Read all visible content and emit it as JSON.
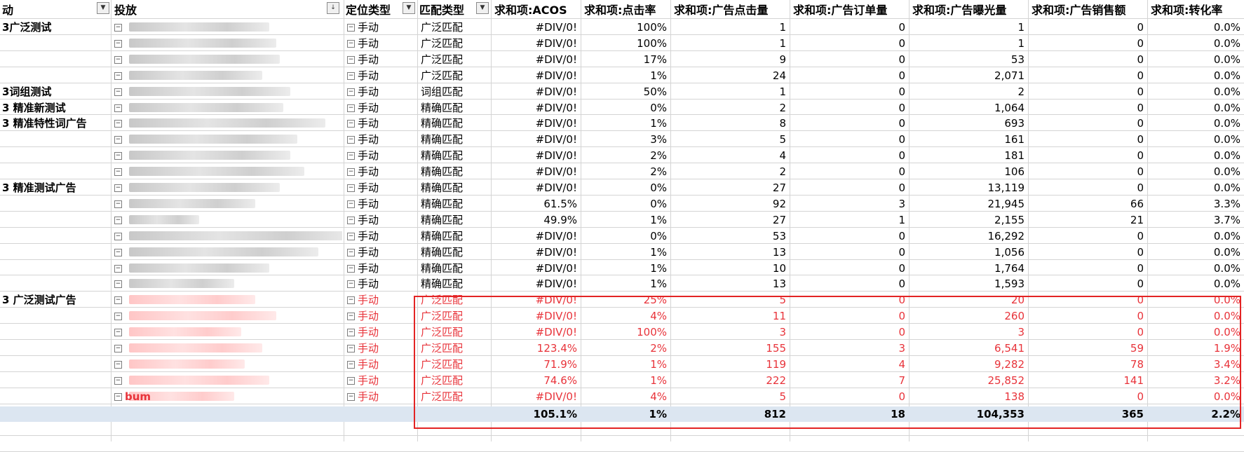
{
  "headers": {
    "campaign": "动",
    "targeting": "投放",
    "position_type": "定位类型",
    "match_type": "匹配类型",
    "acos": "求和项:ACOS",
    "ctr": "求和项:点击率",
    "clicks": "求和项:广告点击量",
    "orders": "求和项:广告订单量",
    "impressions": "求和项:广告曝光量",
    "sales": "求和项:广告销售额",
    "conversion": "求和项:转化率"
  },
  "rows": [
    {
      "campaign": "3广泛测试",
      "targeting": "",
      "position": "手动",
      "match": "广泛匹配",
      "acos": "#DIV/0!",
      "ctr": "100%",
      "clicks": "1",
      "orders": "0",
      "impressions": "1",
      "sales": "0",
      "conversion": "0.0%",
      "red": false
    },
    {
      "campaign": "",
      "targeting": "",
      "position": "手动",
      "match": "广泛匹配",
      "acos": "#DIV/0!",
      "ctr": "100%",
      "clicks": "1",
      "orders": "0",
      "impressions": "1",
      "sales": "0",
      "conversion": "0.0%",
      "red": false
    },
    {
      "campaign": "",
      "targeting": "",
      "position": "手动",
      "match": "广泛匹配",
      "acos": "#DIV/0!",
      "ctr": "17%",
      "clicks": "9",
      "orders": "0",
      "impressions": "53",
      "sales": "0",
      "conversion": "0.0%",
      "red": false
    },
    {
      "campaign": "",
      "targeting": "",
      "position": "手动",
      "match": "广泛匹配",
      "acos": "#DIV/0!",
      "ctr": "1%",
      "clicks": "24",
      "orders": "0",
      "impressions": "2,071",
      "sales": "0",
      "conversion": "0.0%",
      "red": false
    },
    {
      "campaign": "3词组测试",
      "targeting": "",
      "position": "手动",
      "match": "词组匹配",
      "acos": "#DIV/0!",
      "ctr": "50%",
      "clicks": "1",
      "orders": "0",
      "impressions": "2",
      "sales": "0",
      "conversion": "0.0%",
      "red": false
    },
    {
      "campaign": "3 精准新测试",
      "targeting": "",
      "position": "手动",
      "match": "精确匹配",
      "acos": "#DIV/0!",
      "ctr": "0%",
      "clicks": "2",
      "orders": "0",
      "impressions": "1,064",
      "sales": "0",
      "conversion": "0.0%",
      "red": false
    },
    {
      "campaign": "3 精准特性词广告",
      "targeting": "",
      "position": "手动",
      "match": "精确匹配",
      "acos": "#DIV/0!",
      "ctr": "1%",
      "clicks": "8",
      "orders": "0",
      "impressions": "693",
      "sales": "0",
      "conversion": "0.0%",
      "red": false
    },
    {
      "campaign": "",
      "targeting": "",
      "position": "手动",
      "match": "精确匹配",
      "acos": "#DIV/0!",
      "ctr": "3%",
      "clicks": "5",
      "orders": "0",
      "impressions": "161",
      "sales": "0",
      "conversion": "0.0%",
      "red": false
    },
    {
      "campaign": "",
      "targeting": "",
      "position": "手动",
      "match": "精确匹配",
      "acos": "#DIV/0!",
      "ctr": "2%",
      "clicks": "4",
      "orders": "0",
      "impressions": "181",
      "sales": "0",
      "conversion": "0.0%",
      "red": false
    },
    {
      "campaign": "",
      "targeting": "",
      "position": "手动",
      "match": "精确匹配",
      "acos": "#DIV/0!",
      "ctr": "2%",
      "clicks": "2",
      "orders": "0",
      "impressions": "106",
      "sales": "0",
      "conversion": "0.0%",
      "red": false
    },
    {
      "campaign": "3 精准测试广告",
      "targeting": "",
      "position": "手动",
      "match": "精确匹配",
      "acos": "#DIV/0!",
      "ctr": "0%",
      "clicks": "27",
      "orders": "0",
      "impressions": "13,119",
      "sales": "0",
      "conversion": "0.0%",
      "red": false
    },
    {
      "campaign": "",
      "targeting": "",
      "position": "手动",
      "match": "精确匹配",
      "acos": "61.5%",
      "ctr": "0%",
      "clicks": "92",
      "orders": "3",
      "impressions": "21,945",
      "sales": "66",
      "conversion": "3.3%",
      "red": false
    },
    {
      "campaign": "",
      "targeting": "",
      "position": "手动",
      "match": "精确匹配",
      "acos": "49.9%",
      "ctr": "1%",
      "clicks": "27",
      "orders": "1",
      "impressions": "2,155",
      "sales": "21",
      "conversion": "3.7%",
      "red": false
    },
    {
      "campaign": "",
      "targeting": "",
      "position": "手动",
      "match": "精确匹配",
      "acos": "#DIV/0!",
      "ctr": "0%",
      "clicks": "53",
      "orders": "0",
      "impressions": "16,292",
      "sales": "0",
      "conversion": "0.0%",
      "red": false
    },
    {
      "campaign": "",
      "targeting": "",
      "position": "手动",
      "match": "精确匹配",
      "acos": "#DIV/0!",
      "ctr": "1%",
      "clicks": "13",
      "orders": "0",
      "impressions": "1,056",
      "sales": "0",
      "conversion": "0.0%",
      "red": false
    },
    {
      "campaign": "",
      "targeting": "",
      "position": "手动",
      "match": "精确匹配",
      "acos": "#DIV/0!",
      "ctr": "1%",
      "clicks": "10",
      "orders": "0",
      "impressions": "1,764",
      "sales": "0",
      "conversion": "0.0%",
      "red": false
    },
    {
      "campaign": "",
      "targeting": "",
      "position": "手动",
      "match": "精确匹配",
      "acos": "#DIV/0!",
      "ctr": "1%",
      "clicks": "13",
      "orders": "0",
      "impressions": "1,593",
      "sales": "0",
      "conversion": "0.0%",
      "red": false
    },
    {
      "campaign": "3 广泛测试广告",
      "targeting": "",
      "position": "手动",
      "match": "广泛匹配",
      "acos": "#DIV/0!",
      "ctr": "25%",
      "clicks": "5",
      "orders": "0",
      "impressions": "20",
      "sales": "0",
      "conversion": "0.0%",
      "red": true
    },
    {
      "campaign": "",
      "targeting": "",
      "position": "手动",
      "match": "广泛匹配",
      "acos": "#DIV/0!",
      "ctr": "4%",
      "clicks": "11",
      "orders": "0",
      "impressions": "260",
      "sales": "0",
      "conversion": "0.0%",
      "red": true
    },
    {
      "campaign": "",
      "targeting": "",
      "position": "手动",
      "match": "广泛匹配",
      "acos": "#DIV/0!",
      "ctr": "100%",
      "clicks": "3",
      "orders": "0",
      "impressions": "3",
      "sales": "0",
      "conversion": "0.0%",
      "red": true
    },
    {
      "campaign": "",
      "targeting": "",
      "position": "手动",
      "match": "广泛匹配",
      "acos": "123.4%",
      "ctr": "2%",
      "clicks": "155",
      "orders": "3",
      "impressions": "6,541",
      "sales": "59",
      "conversion": "1.9%",
      "red": true
    },
    {
      "campaign": "",
      "targeting": "",
      "position": "手动",
      "match": "广泛匹配",
      "acos": "71.9%",
      "ctr": "1%",
      "clicks": "119",
      "orders": "4",
      "impressions": "9,282",
      "sales": "78",
      "conversion": "3.4%",
      "red": true
    },
    {
      "campaign": "",
      "targeting": "",
      "position": "手动",
      "match": "广泛匹配",
      "acos": "74.6%",
      "ctr": "1%",
      "clicks": "222",
      "orders": "7",
      "impressions": "25,852",
      "sales": "141",
      "conversion": "3.2%",
      "red": true
    },
    {
      "campaign": "",
      "targeting": "bum",
      "position": "手动",
      "match": "广泛匹配",
      "acos": "#DIV/0!",
      "ctr": "4%",
      "clicks": "5",
      "orders": "0",
      "impressions": "138",
      "sales": "0",
      "conversion": "0.0%",
      "red": true
    }
  ],
  "totals": {
    "acos": "105.1%",
    "ctr": "1%",
    "clicks": "812",
    "orders": "18",
    "impressions": "104,353",
    "sales": "365",
    "conversion": "2.2%"
  },
  "colors": {
    "highlight_red": "#e8333a",
    "total_row_bg": "#dce6f1",
    "box_border": "#e32424"
  }
}
